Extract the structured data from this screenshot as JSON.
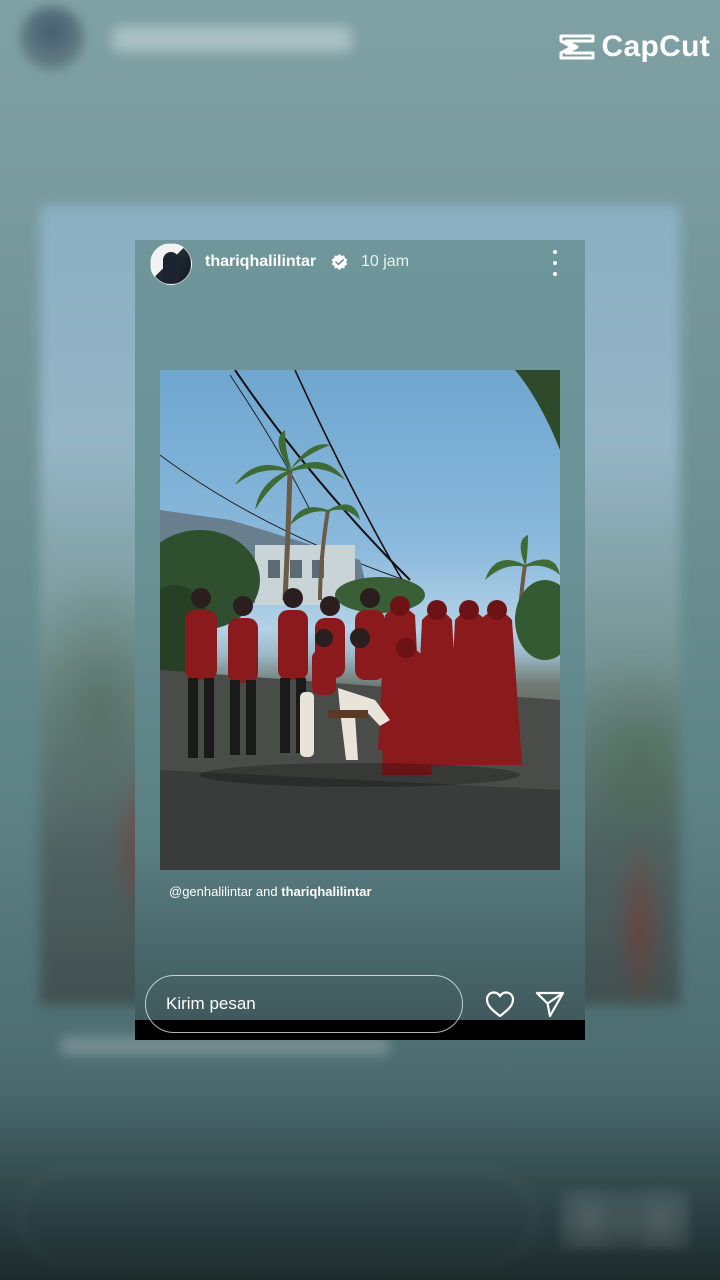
{
  "watermark": {
    "brand": "CapCut",
    "icon": "capcut-logo-icon"
  },
  "story": {
    "username": "thariqhalilintar",
    "verified_icon": "verified-badge-icon",
    "time": "10 jam",
    "menu_icon": "more-vertical-icon",
    "caption_mention": "@genhalilintar",
    "caption_and": " and ",
    "caption_user": "thariqhalilintar"
  },
  "reply": {
    "placeholder": "Kirim pesan",
    "like_icon": "heart-icon",
    "share_icon": "send-icon"
  },
  "colors": {
    "accent": "#ffffff",
    "outfit": "#8b1a1c"
  }
}
